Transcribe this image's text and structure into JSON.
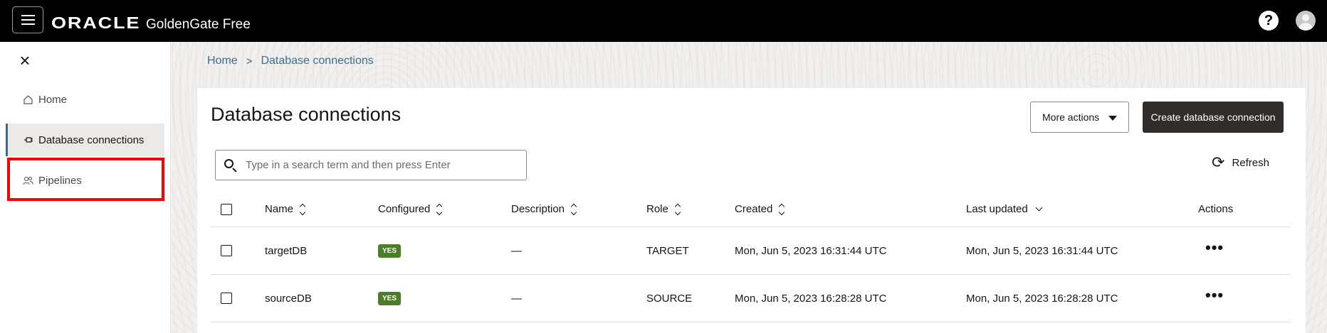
{
  "topbar": {
    "brand_logo": "ORACLE",
    "product_name": "GoldenGate Free",
    "help_label": "?"
  },
  "sidebar": {
    "close_label": "×",
    "items": [
      {
        "label": "Home",
        "icon": "home-icon"
      },
      {
        "label": "Database connections",
        "icon": "plug-icon",
        "active": true
      },
      {
        "label": "Pipelines",
        "icon": "users-icon",
        "highlighted": true
      }
    ]
  },
  "breadcrumb": {
    "home": "Home",
    "separator": ">",
    "current": "Database connections"
  },
  "page": {
    "title": "Database connections",
    "more_actions_label": "More actions",
    "create_label": "Create database connection",
    "search_placeholder": "Type in a search term and then press Enter",
    "refresh_label": "Refresh"
  },
  "table": {
    "columns": [
      "Name",
      "Configured",
      "Description",
      "Role",
      "Created",
      "Last updated",
      "Actions"
    ],
    "rows": [
      {
        "name": "targetDB",
        "configured": "YES",
        "description": "—",
        "role": "TARGET",
        "created": "Mon, Jun 5, 2023 16:31:44 UTC",
        "last_updated": "Mon, Jun 5, 2023 16:31:44 UTC",
        "actions": "•••"
      },
      {
        "name": "sourceDB",
        "configured": "YES",
        "description": "—",
        "role": "SOURCE",
        "created": "Mon, Jun 5, 2023 16:28:28 UTC",
        "last_updated": "Mon, Jun 5, 2023 16:28:28 UTC",
        "actions": "•••"
      }
    ]
  },
  "colors": {
    "topbar_bg": "#000000",
    "create_button_bg": "#312d2a",
    "badge_green": "#4c7d29",
    "link_blue": "#3b6e8f",
    "highlight_red": "#ff0000"
  }
}
